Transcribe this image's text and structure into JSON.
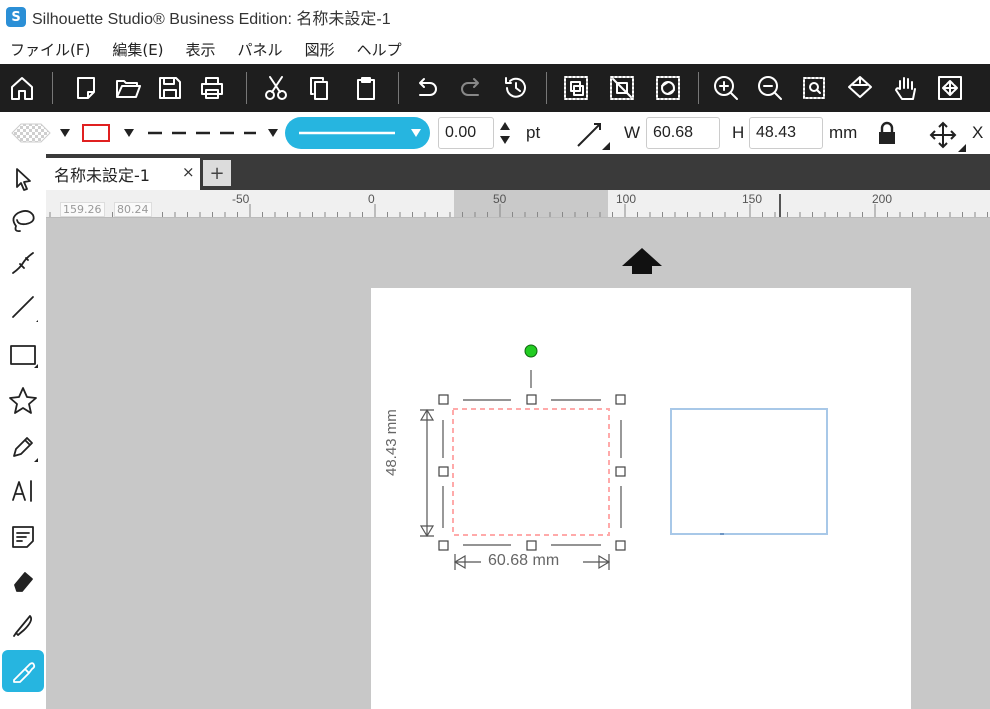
{
  "window": {
    "title": "Silhouette Studio® Business Edition: 名称未設定-1",
    "logo_letter": "S"
  },
  "menu": [
    "ファイル(F)",
    "編集(E)",
    "表示",
    "パネル",
    "図形",
    "ヘルプ"
  ],
  "properties": {
    "line_width_value": "0.00",
    "line_width_unit": "pt",
    "width_label": "W",
    "width_value": "60.68",
    "height_label": "H",
    "height_value": "48.43",
    "size_unit": "mm",
    "position_label": "X"
  },
  "tab": {
    "label": "名称未設定-1",
    "close": "×",
    "add": "+"
  },
  "ruler": {
    "box1": "159.26",
    "box2": "80.24",
    "labels": [
      "-50",
      "0",
      "50",
      "100",
      "150",
      "200"
    ]
  },
  "selection": {
    "height_dimension": "48.43 mm",
    "width_dimension": "60.68 mm"
  },
  "colors": {
    "accent": "#26b5e0",
    "toolbar_bg": "#1e1e1e",
    "rotate_handle": "#22cc22",
    "selected_outline": "#ffaaaa",
    "shape_outline": "#a8c8e8",
    "line_color_swatch": "#e02020"
  }
}
